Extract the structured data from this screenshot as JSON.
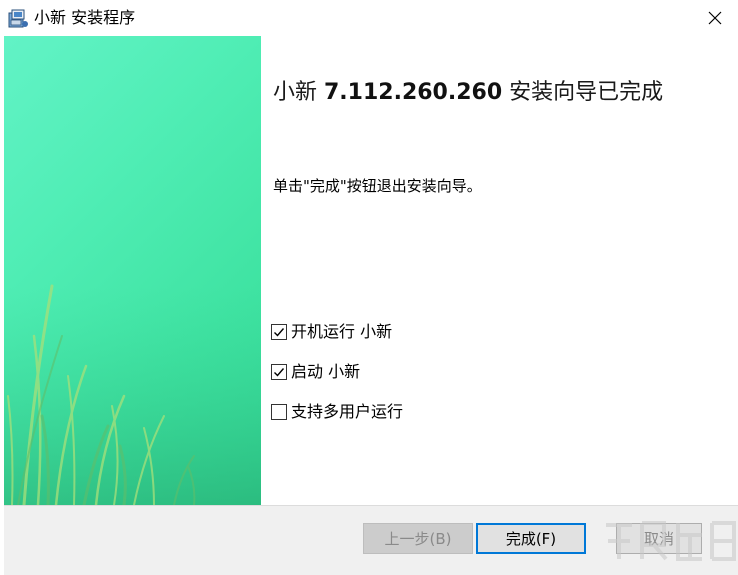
{
  "window": {
    "title": "小新 安装程序",
    "close_symbol": "✕"
  },
  "content": {
    "heading_prefix": "小新 ",
    "heading_version": "7.112.260.260",
    "heading_suffix": " 安装向导已完成",
    "instruction": "单击\"完成\"按钮退出安装向导。"
  },
  "options": [
    {
      "label": "开机运行 小新",
      "checked": true
    },
    {
      "label": "启动 小新",
      "checked": true
    },
    {
      "label": "支持多用户运行",
      "checked": false
    }
  ],
  "buttons": {
    "back": "上一步(B)",
    "finish": "完成(F)",
    "cancel": "取消"
  },
  "colors": {
    "banner_light": "#62f3c6",
    "banner_dark": "#35d897",
    "focus_border": "#0078d7",
    "footer_bg": "#f0f0f0"
  },
  "icons": [
    "installer-icon",
    "close-icon",
    "checkmark-icon"
  ]
}
